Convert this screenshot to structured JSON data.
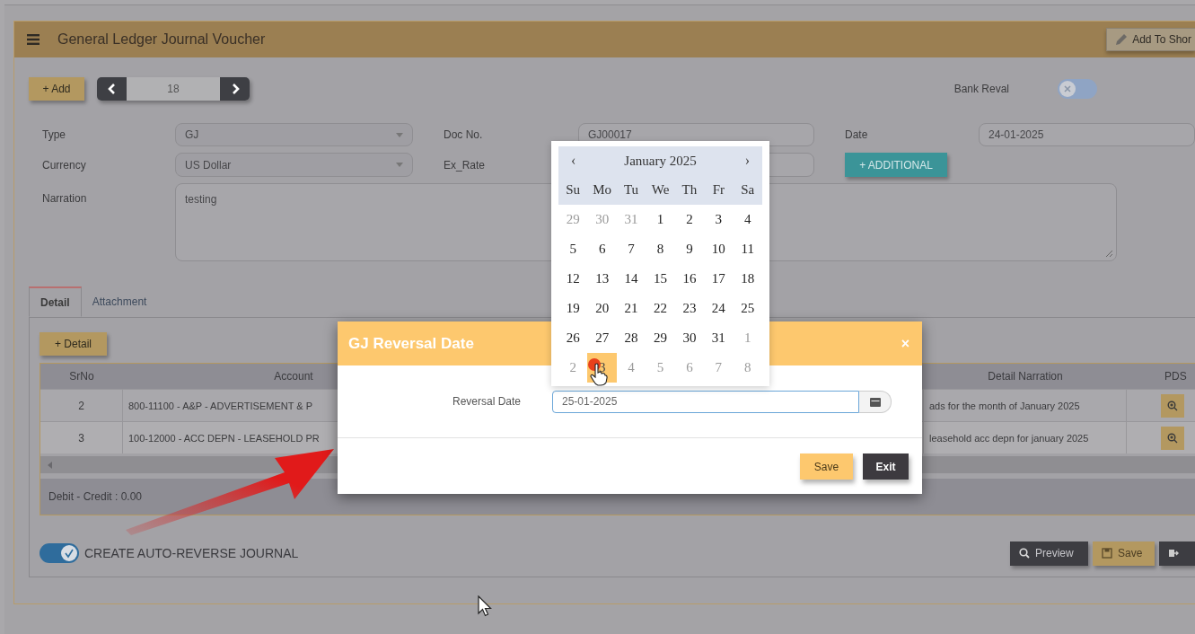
{
  "header": {
    "title": "General Ledger Journal Voucher",
    "shortcut_button": "Add To Shor"
  },
  "toolbar": {
    "add_button": "+ Add",
    "record_number": "18",
    "bank_reval": {
      "label": "Bank Reval",
      "on": false
    }
  },
  "form": {
    "fields": [
      {
        "label": "Type",
        "value": "GJ",
        "kind": "select"
      },
      {
        "label": "Doc No.",
        "value": "GJ00017",
        "kind": "input"
      },
      {
        "label": "Date",
        "value": "24-01-2025",
        "kind": "input"
      },
      {
        "label": "Currency",
        "value": "US Dollar",
        "kind": "select"
      },
      {
        "label": "Ex_Rate",
        "kind": "input"
      },
      {
        "label": "+ ADDITIONAL",
        "kind": "button"
      },
      {
        "label": "Narration",
        "value": "testing",
        "kind": "textarea"
      }
    ]
  },
  "tabs": [
    {
      "label": "Detail",
      "selected": true
    },
    {
      "label": "Attachment",
      "selected": false
    }
  ],
  "detail_button": "+ Detail",
  "table": {
    "columns": [
      "SrNo",
      "Account",
      "Detail Narration",
      "PDS"
    ],
    "rows": [
      {
        "cells": [
          "2",
          "800-11100 - A&P - ADVERTISEMENT & P",
          "ads for the month of January 2025"
        ]
      },
      {
        "cells": [
          "3",
          "100-12000 - ACC DEPN - LEASEHOLD PR",
          "leasehold acc depn for january 2025"
        ]
      }
    ],
    "footer": "Debit - Credit : 0.00"
  },
  "auto_reverse": {
    "label": "CREATE AUTO-REVERSE JOURNAL",
    "on": true
  },
  "actions": [
    {
      "label": "Preview",
      "kind": "preview"
    },
    {
      "label": "Save",
      "kind": "save"
    },
    {
      "kind": "exit"
    }
  ],
  "dialog": {
    "title": "GJ Reversal Date",
    "close": "×",
    "field_label": "Reversal Date",
    "value": "25-01-2025",
    "buttons": [
      {
        "label": "Save",
        "kind": "primary"
      },
      {
        "label": "Exit",
        "kind": "dark"
      }
    ]
  },
  "calendar": {
    "prev": "‹",
    "next": "›",
    "month": "January 2025",
    "weekdays": [
      "Su",
      "Mo",
      "Tu",
      "We",
      "Th",
      "Fr",
      "Sa"
    ],
    "days": [
      {
        "label": "29",
        "muted": true,
        "selected": false
      },
      {
        "label": "30",
        "muted": true,
        "selected": false
      },
      {
        "label": "31",
        "muted": true,
        "selected": false
      },
      {
        "label": "1",
        "muted": false,
        "selected": false
      },
      {
        "label": "2",
        "muted": false,
        "selected": false
      },
      {
        "label": "3",
        "muted": false,
        "selected": false
      },
      {
        "label": "4",
        "muted": false,
        "selected": false
      },
      {
        "label": "5",
        "muted": false,
        "selected": false
      },
      {
        "label": "6",
        "muted": false,
        "selected": false
      },
      {
        "label": "7",
        "muted": false,
        "selected": false
      },
      {
        "label": "8",
        "muted": false,
        "selected": false
      },
      {
        "label": "9",
        "muted": false,
        "selected": false
      },
      {
        "label": "10",
        "muted": false,
        "selected": false
      },
      {
        "label": "11",
        "muted": false,
        "selected": false
      },
      {
        "label": "12",
        "muted": false,
        "selected": false
      },
      {
        "label": "13",
        "muted": false,
        "selected": false
      },
      {
        "label": "14",
        "muted": false,
        "selected": false
      },
      {
        "label": "15",
        "muted": false,
        "selected": false
      },
      {
        "label": "16",
        "muted": false,
        "selected": false
      },
      {
        "label": "17",
        "muted": false,
        "selected": false
      },
      {
        "label": "18",
        "muted": false,
        "selected": false
      },
      {
        "label": "19",
        "muted": false,
        "selected": false
      },
      {
        "label": "20",
        "muted": false,
        "selected": false
      },
      {
        "label": "21",
        "muted": false,
        "selected": false
      },
      {
        "label": "22",
        "muted": false,
        "selected": false
      },
      {
        "label": "23",
        "muted": false,
        "selected": false
      },
      {
        "label": "24",
        "muted": false,
        "selected": false
      },
      {
        "label": "25",
        "muted": false,
        "selected": false
      },
      {
        "label": "26",
        "muted": false,
        "selected": false
      },
      {
        "label": "27",
        "muted": false,
        "selected": false
      },
      {
        "label": "28",
        "muted": false,
        "selected": false
      },
      {
        "label": "29",
        "muted": false,
        "selected": false
      },
      {
        "label": "30",
        "muted": false,
        "selected": false
      },
      {
        "label": "31",
        "muted": false,
        "selected": false
      },
      {
        "label": "1",
        "muted": true,
        "selected": false
      },
      {
        "label": "2",
        "muted": true,
        "selected": false
      },
      {
        "label": "3",
        "muted": true,
        "selected": true
      },
      {
        "label": "4",
        "muted": true,
        "selected": false
      },
      {
        "label": "5",
        "muted": true,
        "selected": false
      },
      {
        "label": "6",
        "muted": true,
        "selected": false
      },
      {
        "label": "7",
        "muted": true,
        "selected": false
      },
      {
        "label": "8",
        "muted": true,
        "selected": false
      }
    ]
  }
}
